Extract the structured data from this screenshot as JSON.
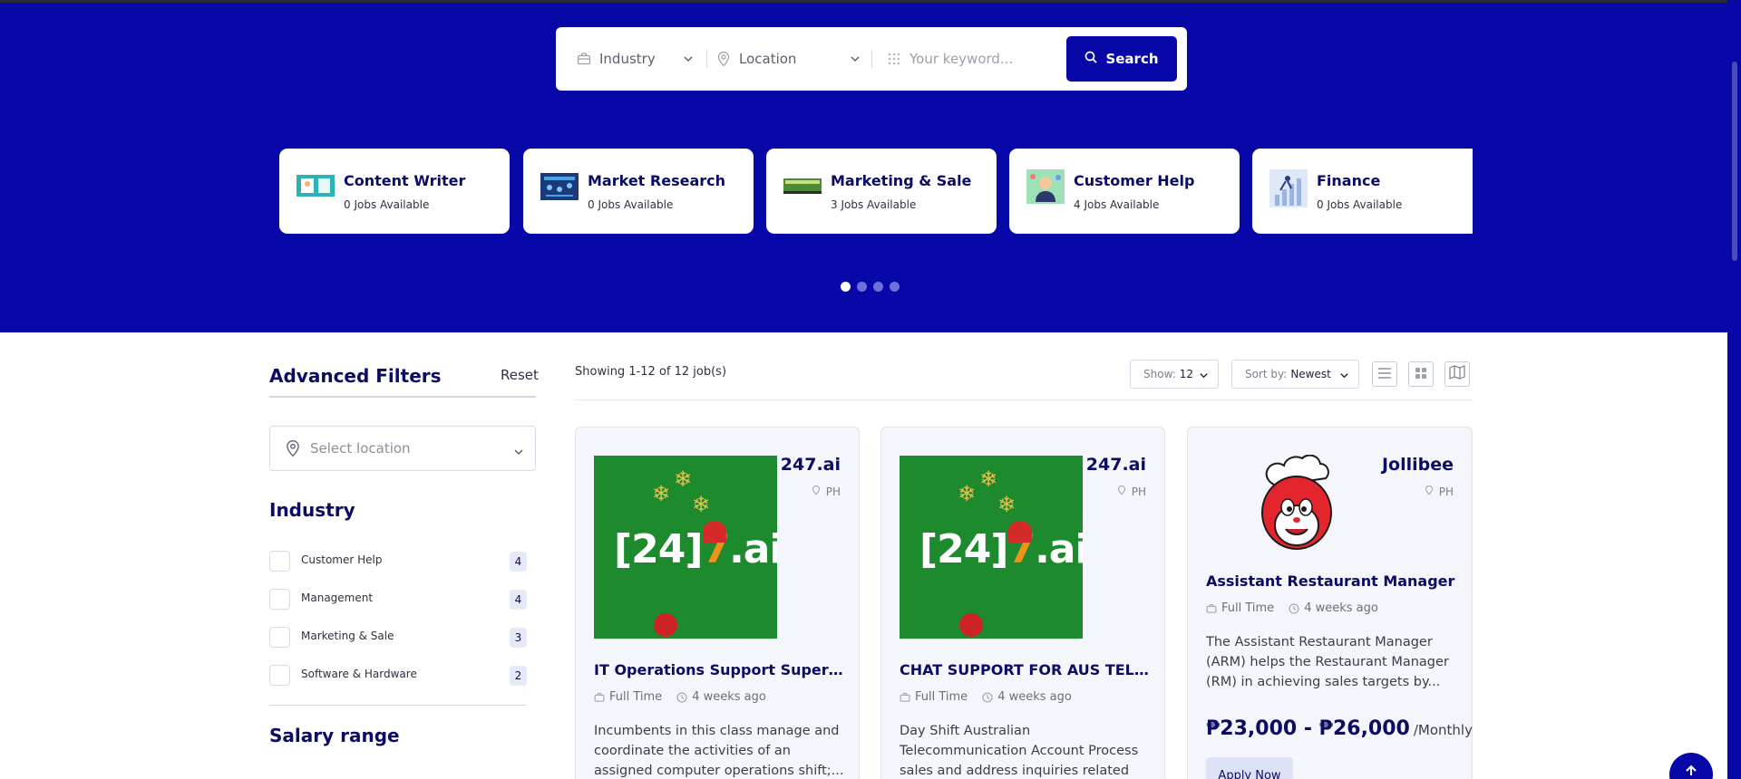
{
  "search": {
    "industry_label": "Industry",
    "location_label": "Location",
    "keyword_placeholder": "Your keyword...",
    "button_label": "Search"
  },
  "categories": [
    {
      "title": "Content Writer",
      "count": "0 Jobs Available"
    },
    {
      "title": "Market Research",
      "count": "0 Jobs Available"
    },
    {
      "title": "Marketing & Sale",
      "count": "3 Jobs Available"
    },
    {
      "title": "Customer Help",
      "count": "4 Jobs Available"
    },
    {
      "title": "Finance",
      "count": "0 Jobs Available"
    }
  ],
  "carousel": {
    "pages": 4,
    "active_page": 1
  },
  "filters": {
    "title": "Advanced Filters",
    "reset_label": "Reset",
    "location_placeholder": "Select location",
    "industry_title": "Industry",
    "industries": [
      {
        "label": "Customer Help",
        "count": "4"
      },
      {
        "label": "Management",
        "count": "4"
      },
      {
        "label": "Marketing & Sale",
        "count": "3"
      },
      {
        "label": "Software & Hardware",
        "count": "2"
      }
    ],
    "salary_title": "Salary range"
  },
  "toolbar": {
    "showing_text": "Showing 1-12 of 12 job(s)",
    "show_label": "Show:",
    "show_value": "12",
    "sort_label": "Sort by:",
    "sort_value": "Newest"
  },
  "jobs": [
    {
      "company": "247.ai",
      "country": "PH",
      "logo_text_a": "[24]",
      "logo_text_b": "7",
      "logo_text_c": ".ai",
      "title": "IT Operations Support Supervisor",
      "type": "Full Time",
      "posted": "4 weeks ago",
      "description": "Incumbents in this class manage and coordinate the activities of an assigned computer operations shift;..."
    },
    {
      "company": "247.ai",
      "country": "PH",
      "logo_text_a": "[24]",
      "logo_text_b": "7",
      "logo_text_c": ".ai",
      "title": "CHAT SUPPORT FOR AUS TELCO",
      "type": "Full Time",
      "posted": "4 weeks ago",
      "description": "Day Shift Australian Telecommunication Account Process sales and address inquiries related t..."
    },
    {
      "company": "Jollibee",
      "country": "PH",
      "title": "Assistant Restaurant Manager",
      "type": "Full Time",
      "posted": "4 weeks ago",
      "description": "The Assistant Restaurant Manager (ARM) helps the Restaurant Manager (RM) in achieving sales targets by...",
      "salary": "₱23,000 - ₱26,000",
      "salary_period": "/Monthly",
      "apply_label": "Apply Now"
    }
  ],
  "icons": {
    "briefcase": "briefcase-icon",
    "pin": "location-pin-icon",
    "grid": "keyword-grid-icon",
    "search": "search-icon",
    "clock": "clock-icon",
    "list_view": "list-view-icon",
    "grid_view": "grid-view-icon",
    "map_view": "map-view-icon",
    "arrow_up": "arrow-up-icon"
  },
  "colors": {
    "brand": "#0808a8",
    "heading": "#0c0c64",
    "card_bg": "#f5f6fc"
  }
}
